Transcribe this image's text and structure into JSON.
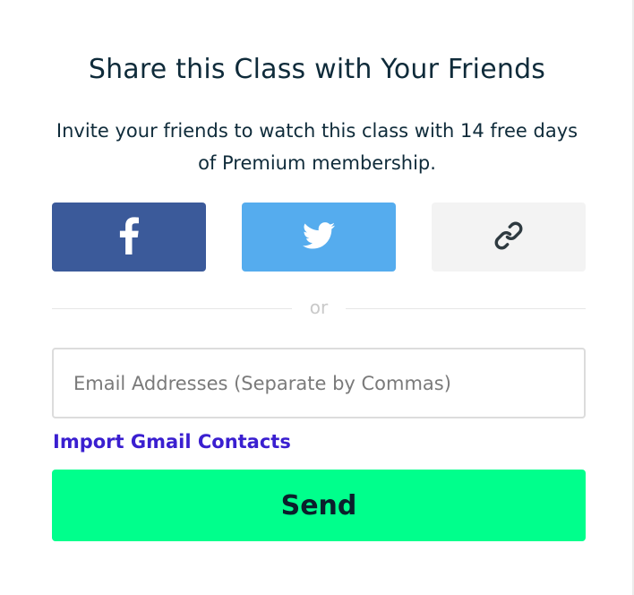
{
  "modal": {
    "title": "Share this Class with Your Friends",
    "subtitle": "Invite your friends to watch this class with 14 free days of Premium membership."
  },
  "share": {
    "facebook": {
      "icon": "facebook-icon",
      "color": "#3b5a9a"
    },
    "twitter": {
      "icon": "twitter-icon",
      "color": "#55acee"
    },
    "copy_link": {
      "icon": "link-icon",
      "color": "#f3f3f3"
    }
  },
  "divider": {
    "text": "or"
  },
  "email": {
    "placeholder": "Email Addresses (Separate by Commas)",
    "value": ""
  },
  "import": {
    "label": "Import Gmail Contacts",
    "color": "#3a1fd0"
  },
  "send": {
    "label": "Send",
    "color": "#00ff8c"
  }
}
